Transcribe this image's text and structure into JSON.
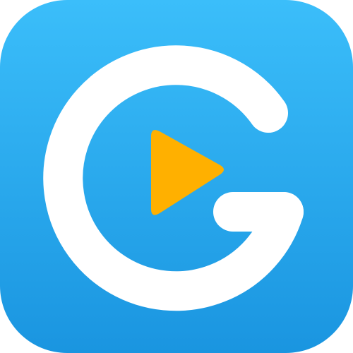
{
  "icon": {
    "semantic": "app-logo-g-play-icon",
    "colors": {
      "background_top": "#3BBEFA",
      "background_bottom": "#1A95E0",
      "letter": "#FFFFFF",
      "play": "#FFB000"
    }
  }
}
